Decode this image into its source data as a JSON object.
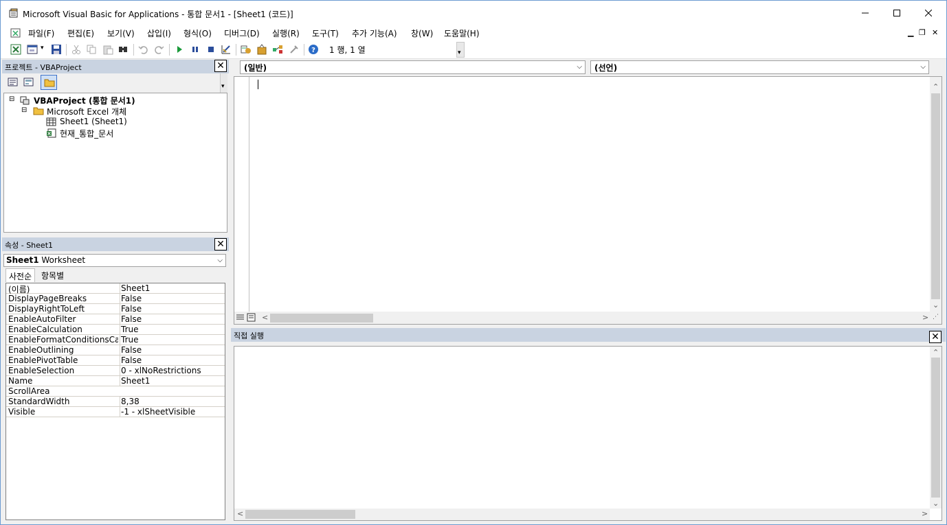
{
  "window": {
    "title": "Microsoft Visual Basic for Applications - 통합 문서1 - [Sheet1 (코드)]"
  },
  "menu": [
    "파일(F)",
    "편집(E)",
    "보기(V)",
    "삽입(I)",
    "형식(O)",
    "디버그(D)",
    "실행(R)",
    "도구(T)",
    "추가 기능(A)",
    "창(W)",
    "도움말(H)"
  ],
  "toolbar": {
    "cursor_position": "1 행, 1 열"
  },
  "project_pane": {
    "title": "프로젝트 - VBAProject",
    "tree": {
      "root": "VBAProject (통합 문서1)",
      "folder": "Microsoft Excel 개체",
      "items": [
        "Sheet1 (Sheet1)",
        "현재_통합_문서"
      ]
    }
  },
  "properties_pane": {
    "title": "속성 - Sheet1",
    "object_name": "Sheet1",
    "object_type": "Worksheet",
    "tabs": [
      "사전순",
      "항목별"
    ],
    "rows": [
      {
        "name": "(이름)",
        "value": "Sheet1"
      },
      {
        "name": "DisplayPageBreaks",
        "value": "False"
      },
      {
        "name": "DisplayRightToLeft",
        "value": "False"
      },
      {
        "name": "EnableAutoFilter",
        "value": "False"
      },
      {
        "name": "EnableCalculation",
        "value": "True"
      },
      {
        "name": "EnableFormatConditionsCalculation",
        "value": "True"
      },
      {
        "name": "EnableOutlining",
        "value": "False"
      },
      {
        "name": "EnablePivotTable",
        "value": "False"
      },
      {
        "name": "EnableSelection",
        "value": "0 - xlNoRestrictions"
      },
      {
        "name": "Name",
        "value": "Sheet1"
      },
      {
        "name": "ScrollArea",
        "value": ""
      },
      {
        "name": "StandardWidth",
        "value": "8,38"
      },
      {
        "name": "Visible",
        "value": "-1 - xlSheetVisible"
      }
    ]
  },
  "code_window": {
    "object_combo": "(일반)",
    "procedure_combo": "(선언)"
  },
  "immediate_pane": {
    "title": "직접 실행"
  }
}
